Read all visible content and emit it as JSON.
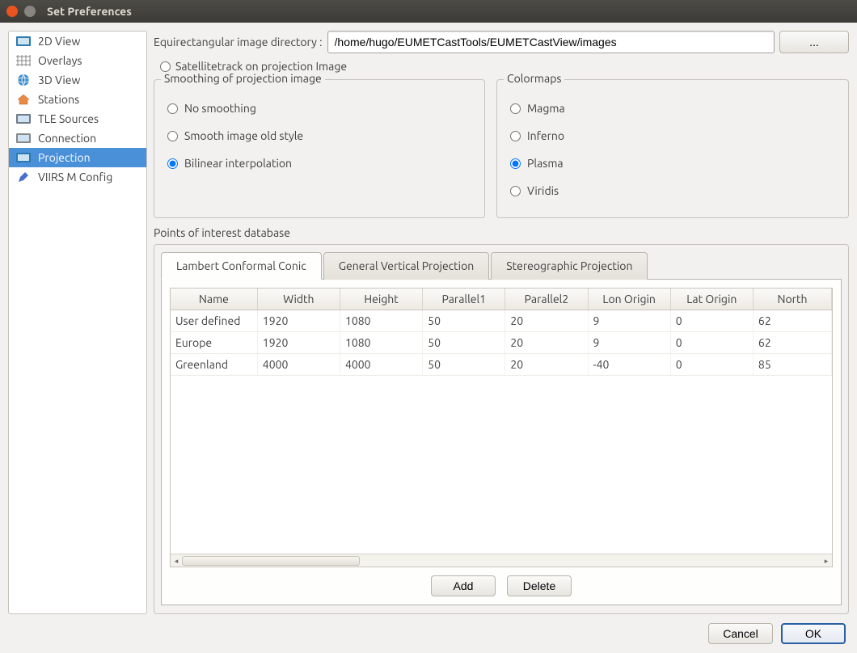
{
  "window": {
    "title": "Set Preferences"
  },
  "sidebar": {
    "items": [
      {
        "label": "2D View",
        "icon": "map-2d"
      },
      {
        "label": "Overlays",
        "icon": "grid"
      },
      {
        "label": "3D View",
        "icon": "globe"
      },
      {
        "label": "Stations",
        "icon": "house"
      },
      {
        "label": "TLE Sources",
        "icon": "printer"
      },
      {
        "label": "Connection",
        "icon": "gear"
      },
      {
        "label": "Projection",
        "icon": "map-proj"
      },
      {
        "label": "VIIRS M Config",
        "icon": "pen"
      }
    ],
    "selected_index": 6
  },
  "top_row": {
    "label": "Equirectangular image directory :",
    "value": "/home/hugo/EUMETCastTools/EUMETCastView/images",
    "browse": "..."
  },
  "sat_track": {
    "label": "Satellitetrack on projection Image",
    "checked": false
  },
  "smoothing": {
    "legend": "Smoothing of projection image",
    "options": [
      {
        "label": "No smoothing"
      },
      {
        "label": "Smooth image old style"
      },
      {
        "label": "Bilinear interpolation"
      }
    ],
    "selected_index": 2
  },
  "colormaps": {
    "legend": "Colormaps",
    "options": [
      {
        "label": "Magma"
      },
      {
        "label": "Inferno"
      },
      {
        "label": "Plasma"
      },
      {
        "label": "Viridis"
      }
    ],
    "selected_index": 2
  },
  "poi": {
    "label": "Points of interest database",
    "tabs": [
      {
        "label": "Lambert Conformal Conic"
      },
      {
        "label": "General Vertical Projection"
      },
      {
        "label": "Stereographic Projection"
      }
    ],
    "active_tab": 0,
    "columns": [
      "Name",
      "Width",
      "Height",
      "Parallel1",
      "Parallel2",
      "Lon Origin",
      "Lat Origin",
      "North"
    ],
    "rows": [
      [
        "User defined",
        "1920",
        "1080",
        "50",
        "20",
        "9",
        "0",
        "62"
      ],
      [
        "Europe",
        "1920",
        "1080",
        "50",
        "20",
        "9",
        "0",
        "62"
      ],
      [
        "Greenland",
        "4000",
        "4000",
        "50",
        "20",
        "-40",
        "0",
        "85"
      ]
    ],
    "buttons": {
      "add": "Add",
      "delete": "Delete"
    }
  },
  "footer": {
    "cancel": "Cancel",
    "ok": "OK"
  }
}
